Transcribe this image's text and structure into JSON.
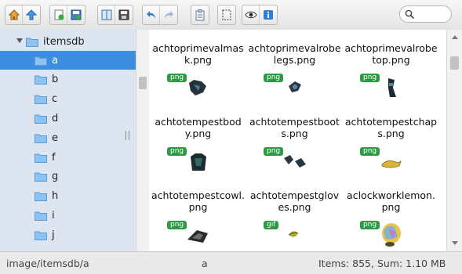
{
  "toolbar": {
    "groups": [
      [
        "home-icon",
        "up-arrow-icon"
      ],
      [
        "new-file-icon",
        "save-icon"
      ],
      [
        "book-icon",
        "floppy-icon"
      ],
      [
        "undo-icon",
        "redo-icon"
      ],
      [
        "clipboard-icon"
      ],
      [
        "select-icon"
      ],
      [
        "eye-icon",
        "info-icon"
      ]
    ],
    "search": {
      "value": "",
      "placeholder": ""
    }
  },
  "tree": {
    "root": "itemsdb",
    "items": [
      "a",
      "b",
      "c",
      "d",
      "e",
      "f",
      "g",
      "h",
      "i",
      "j"
    ],
    "selected": "a"
  },
  "files": [
    {
      "name": "achtoprimevalmask.png",
      "type": "png"
    },
    {
      "name": "achtoprimevalrobelegs.png",
      "type": "png"
    },
    {
      "name": "achtoprimevalrobetop.png",
      "type": "png"
    },
    {
      "name": "achtotempestbody.png",
      "type": "png"
    },
    {
      "name": "achtotempestboots.png",
      "type": "png"
    },
    {
      "name": "achtotempestchaps.png",
      "type": "png"
    },
    {
      "name": "achtotempestcowl.png",
      "type": "png"
    },
    {
      "name": "achtotempestgloves.png",
      "type": "png"
    },
    {
      "name": "aclockworklemon.png",
      "type": "png"
    }
  ],
  "file_badges": [
    "png",
    "png",
    "png",
    "png",
    "png",
    "png",
    "png",
    "gif",
    "png"
  ],
  "status": {
    "path": "image/itemsdb/a",
    "selection": "a",
    "summary": "Items: 855, Sum: 1.10 MB"
  },
  "colors": {
    "selection": "#3d8ee0",
    "badge": "#2e9a45",
    "tree_bg": "#dde6f0"
  }
}
